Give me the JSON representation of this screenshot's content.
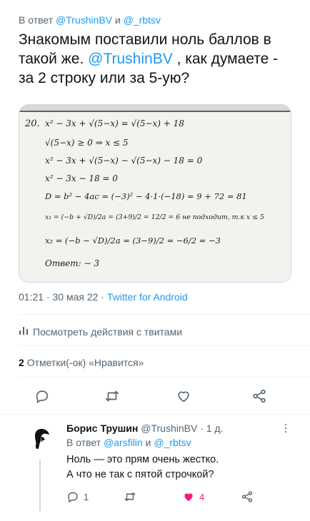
{
  "tweet": {
    "reply_prefix": "В ответ",
    "reply_to_1": "@TrushinBV",
    "reply_and": "и",
    "reply_to_2": "@_rbtsv",
    "text_part1": "Знакомым поставили ноль баллов в такой же.",
    "text_mention": "@TrushinBV",
    "text_part2": ", как думаете - за 2 строку или за 5-ую?",
    "timestamp": "01:21 · 30 мая 22",
    "dot": "·",
    "source": "Twitter for Android",
    "activity_label": "Посмотреть действия с твитами",
    "likes_count": "2",
    "likes_label": "Отметки(-ок) «Нравится»"
  },
  "media": {
    "problem_number": "20.",
    "lines": [
      "x² − 3x + √(5−x) = √(5−x) + 18",
      "√(5−x) ≥ 0  ⇒  x ≤ 5",
      "x² − 3x + √(5−x) − √(5−x) − 18 = 0",
      "x² − 3x − 18 = 0",
      "D = b² − 4ac = (−3)² − 4·1·(−18) = 9 + 72 = 81",
      "x₁ = (−b + √D)/2a = (3+9)/2 = 12/2 = 6  не подходит, т.к  x ≤ 5",
      "x₂ = (−b − √D)/2a = (3−9)/2 = −6/2 = −3",
      "Ответ: − 3"
    ]
  },
  "reply": {
    "name": "Борис Трушин",
    "handle": "@TrushinBV",
    "time": "· 1 д.",
    "reply_prefix": "В ответ",
    "reply_to_1": "@arsfilin",
    "reply_and": "и",
    "reply_to_2": "@_rbtsv",
    "text_line1": "Ноль — это прям очень жестко.",
    "text_line2": "А что не так с пятой строчкой?",
    "reply_count": "1",
    "like_count": "4"
  },
  "colors": {
    "link": "#1d9bf0",
    "muted": "#536471",
    "text": "#0f1419",
    "like": "#f91880"
  },
  "icons": [
    "reply-icon",
    "retweet-icon",
    "like-icon",
    "share-icon",
    "bar-chart-icon",
    "more-icon"
  ]
}
